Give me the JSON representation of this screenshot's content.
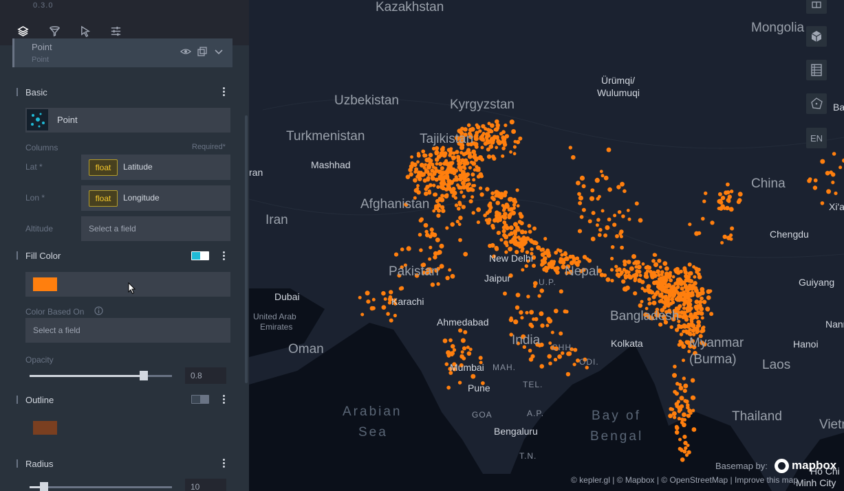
{
  "app": {
    "version": "0.3.0"
  },
  "tabs": [
    {
      "name": "layers",
      "icon": "layers-icon",
      "active": true
    },
    {
      "name": "filters",
      "icon": "filter-icon"
    },
    {
      "name": "interactions",
      "icon": "cursor-icon"
    },
    {
      "name": "map-settings",
      "icon": "sliders-icon"
    }
  ],
  "layer": {
    "name": "Point",
    "type": "Point"
  },
  "basic": {
    "title": "Basic",
    "layer_type_label": "Point",
    "columns_label": "Columns",
    "required_label": "Required*",
    "lat_label": "Lat *",
    "lon_label": "Lon *",
    "altitude_label": "Altitude",
    "lat_type": "float",
    "lat_field": "Latitude",
    "lon_type": "float",
    "lon_field": "Longitude",
    "altitude_placeholder": "Select a field"
  },
  "fill_color": {
    "title": "Fill Color",
    "color": "#ff7f0e",
    "color_based_on_label": "Color Based On",
    "color_based_on_placeholder": "Select a field",
    "opacity_label": "Opacity",
    "opacity_value": "0.8",
    "opacity_fraction": 0.8
  },
  "outline": {
    "title": "Outline",
    "color": "#7a3f20"
  },
  "radius": {
    "title": "Radius",
    "value": "10",
    "fraction": 0.1
  },
  "map": {
    "labels": {
      "kazakhstan": "Kazakhstan",
      "mongolia": "Mongolia",
      "uzbekistan": "Uzbekistan",
      "kyrgyzstan": "Kyrgyzstan",
      "urumqi": "Ürümqi/",
      "wulumuqi": "Wulumuqi",
      "turkmenistan": "Turkmenistan",
      "mashhad": "Mashhad",
      "iran_cut": "ran",
      "tajikistan": "Tajikistan",
      "afghanistan": "Afghanistan",
      "china": "China",
      "xian": "Xi'a",
      "iran": "Iran",
      "chengdu": "Chengdu",
      "new_delhi": "New Delhi",
      "pakistan": "Pakistan",
      "jaipur": "Jaipur",
      "up": "U.P.",
      "nepal": "Nepal",
      "guiyang": "Guiyang",
      "dubai": "Dubai",
      "karachi": "Karachi",
      "uae1": "United Arab",
      "uae2": "Emirates",
      "ahmedabad": "Ahmedabad",
      "bangladesh": "Bangladesh",
      "nanning": "Nanni",
      "india": "India",
      "chh": "CHH.",
      "kolkata": "Kolkata",
      "myanmar1": "Myanmar",
      "myanmar2": "(Burma)",
      "hanoi": "Hanoi",
      "oman": "Oman",
      "laos": "Laos",
      "odi": "ODI.",
      "mumbai": "Mumbai",
      "mah": "MAH.",
      "pune": "Pune",
      "tel": "TEL.",
      "arabian1": "Arabian",
      "arabian2": "Sea",
      "goa": "GOA",
      "ap": "A.P.",
      "bay1": "Bay of",
      "bay2": "Bengal",
      "thailand": "Thailand",
      "vietnam": "Vietna",
      "bengaluru": "Bengaluru",
      "tn": "T.N.",
      "hochi1": "Ho Chi",
      "hochi2": "Minh City",
      "ba_cut": "Ba"
    },
    "controls": {
      "book_icon": "book-icon",
      "3d_icon": "cube-icon",
      "legend_icon": "table-icon",
      "draw_icon": "polygon-icon",
      "locale": "EN"
    },
    "basemap_label": "Basemap by:",
    "mapbox_label": "mapbox",
    "attribution": "© kepler.gl | © Mapbox | © OpenStreetMap | Improve this map",
    "point_color": "#ff7f0e"
  }
}
